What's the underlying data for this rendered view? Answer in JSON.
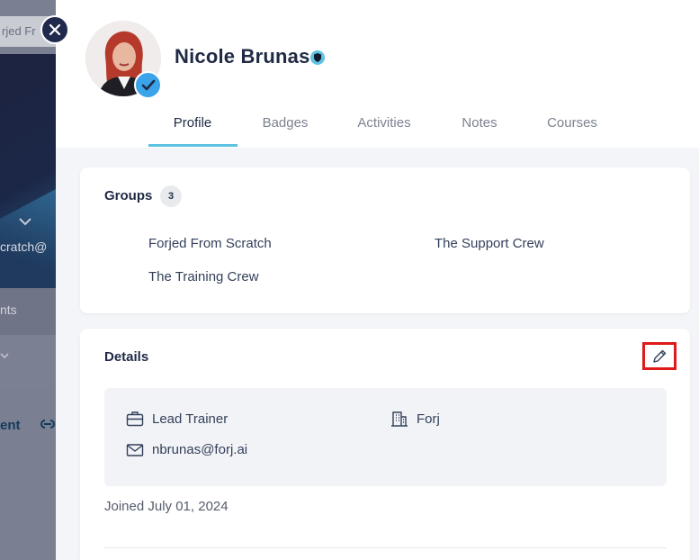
{
  "background": {
    "search_text": "rjed Fr",
    "email_text": "cratch@",
    "nav_text": "nts",
    "tab_text": "ent",
    "link_icon": "link-icon"
  },
  "profile": {
    "name": "Nicole Brunas",
    "verified_icon": "check-icon",
    "badge_icon": "shield-icon"
  },
  "tabs": [
    {
      "label": "Profile",
      "active": true
    },
    {
      "label": "Badges",
      "active": false
    },
    {
      "label": "Activities",
      "active": false
    },
    {
      "label": "Notes",
      "active": false
    },
    {
      "label": "Courses",
      "active": false
    }
  ],
  "groups": {
    "title": "Groups",
    "count": "3",
    "items": [
      "Forjed From Scratch",
      "The Support Crew",
      "The Training Crew"
    ]
  },
  "details": {
    "title": "Details",
    "edit_icon": "pencil-icon",
    "job_title": "Lead Trainer",
    "company": "Forj",
    "email": "nbrunas@forj.ai",
    "joined": "Joined July 01, 2024"
  },
  "colors": {
    "accent": "#5ec3e3",
    "verified": "#3ba3ea",
    "navy": "#1f2a4d",
    "highlight_border": "#e01919"
  }
}
